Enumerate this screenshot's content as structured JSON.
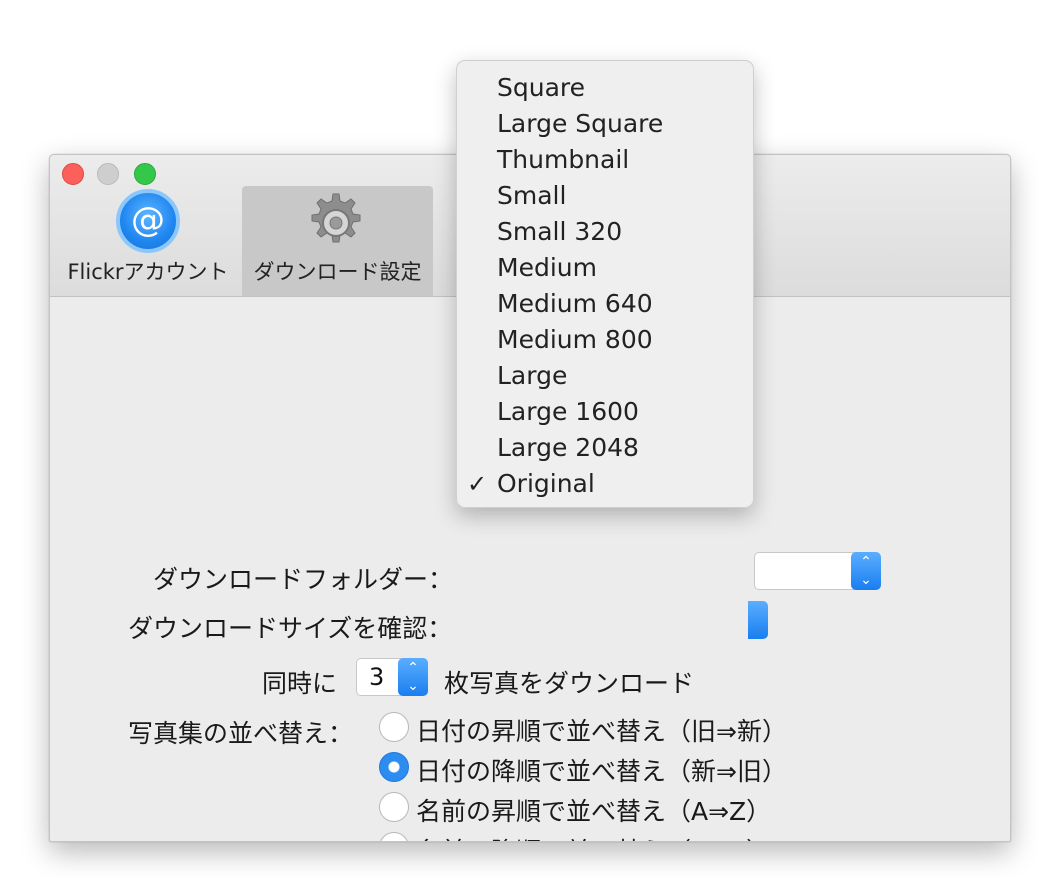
{
  "toolbar": {
    "tabs": [
      {
        "label": "Flickrアカウント",
        "icon": "at-icon"
      },
      {
        "label": "ダウンロード設定",
        "icon": "gear-icon"
      }
    ]
  },
  "settings": {
    "download_folder_label": "ダウンロードフォルダー：",
    "download_size_label": "ダウンロードサイズを確認：",
    "concurrent_prefix": "同時に",
    "concurrent_value": "3",
    "concurrent_suffix": "枚写真をダウンロード",
    "sort_label": "写真集の並べ替え：",
    "sort_options": [
      {
        "label": "日付の昇順で並べ替え（旧⇒新）",
        "checked": false
      },
      {
        "label": "日付の降順で並べ替え（新⇒旧）",
        "checked": true
      },
      {
        "label": "名前の昇順で並べ替え（A⇒Z）",
        "checked": false
      },
      {
        "label": "名前の降順で並べ替え（Z⇒A）",
        "checked": false
      }
    ]
  },
  "size_menu": {
    "items": [
      "Square",
      "Large Square",
      "Thumbnail",
      "Small",
      "Small 320",
      "Medium",
      "Medium 640",
      "Medium 800",
      "Large",
      "Large 1600",
      "Large 2048",
      "Original"
    ],
    "selected": "Original",
    "checkmark": "✓"
  },
  "colors": {
    "accent": "#1f86f0",
    "close": "#fc605b",
    "zoom": "#34c84a"
  }
}
